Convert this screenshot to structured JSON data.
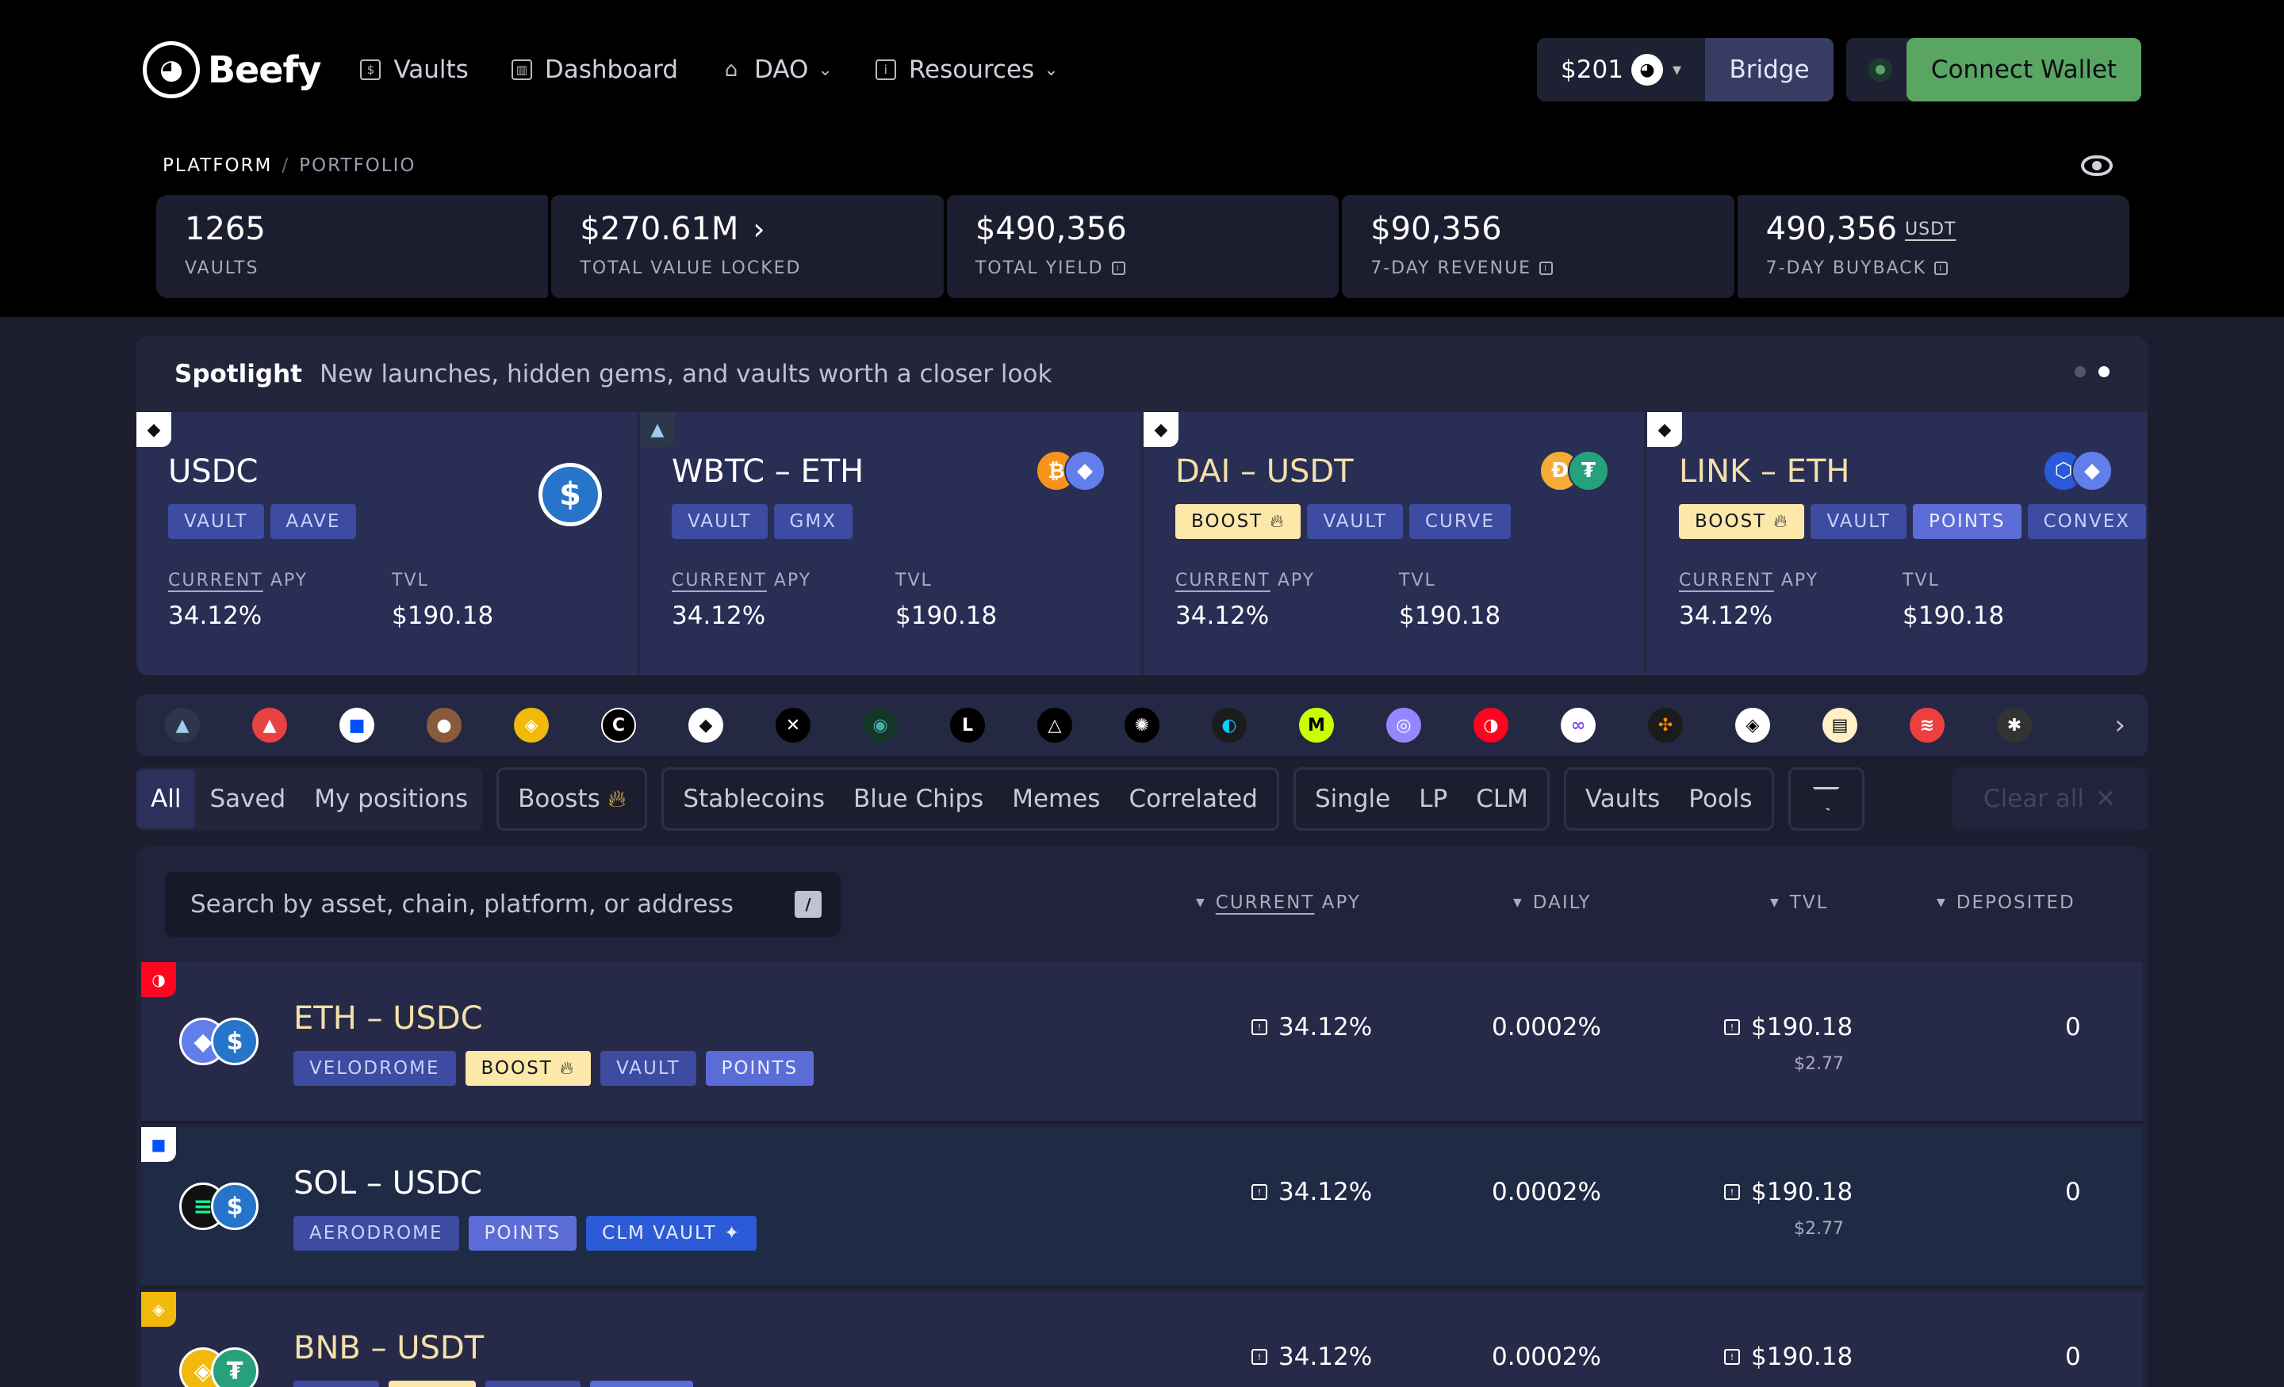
{
  "brand": {
    "name": "Beefy"
  },
  "nav": [
    {
      "label": "Vaults",
      "icon": "vault-icon"
    },
    {
      "label": "Dashboard",
      "icon": "dashboard-icon"
    },
    {
      "label": "DAO",
      "icon": "bank-icon",
      "dropdown": true
    },
    {
      "label": "Resources",
      "icon": "info-icon",
      "dropdown": true
    }
  ],
  "header": {
    "price": "$201",
    "bridge": "Bridge",
    "connect": "Connect Wallet"
  },
  "breadcrumb": {
    "root": "PLATFORM",
    "separator": "/",
    "current": "PORTFOLIO"
  },
  "stats": [
    {
      "value": "1265",
      "label": "VAULTS"
    },
    {
      "value": "$270.61M",
      "label": "TOTAL VALUE LOCKED",
      "arrow": "›"
    },
    {
      "value": "$490,356",
      "label": "TOTAL YIELD",
      "info": true
    },
    {
      "value": "$90,356",
      "label": "7-DAY REVENUE",
      "info": true
    },
    {
      "value": "490,356",
      "unit": "USDT",
      "label": "7-DAY BUYBACK",
      "info": true
    }
  ],
  "spotlight": {
    "title": "Spotlight",
    "subtitle": "New launches, hidden gems, and vaults worth a closer look",
    "apy_head_u": "CURRENT",
    "apy_head": "APY",
    "tvl_head": "TVL",
    "cards": [
      {
        "name": "USDC",
        "tags": [
          "VAULT",
          "AAVE"
        ],
        "apy": "34.12%",
        "tvl": "$190.18"
      },
      {
        "name": "WBTC – ETH",
        "tags": [
          "VAULT",
          "GMX"
        ],
        "apy": "34.12%",
        "tvl": "$190.18"
      },
      {
        "name": "DAI – USDT",
        "tags": [
          "BOOST",
          "VAULT",
          "CURVE"
        ],
        "apy": "34.12%",
        "tvl": "$190.18"
      },
      {
        "name": "LINK – ETH",
        "tags": [
          "BOOST",
          "VAULT",
          "POINTS",
          "CONVEX"
        ],
        "apy": "34.12%",
        "tvl": "$190.18"
      }
    ]
  },
  "filters": {
    "g1": [
      "All",
      "Saved",
      "My positions"
    ],
    "boosts": "Boosts",
    "g3": [
      "Stablecoins",
      "Blue Chips",
      "Memes",
      "Correlated"
    ],
    "g4": [
      "Single",
      "LP",
      "CLM"
    ],
    "g5": [
      "Vaults",
      "Pools"
    ],
    "clear": "Clear all"
  },
  "list": {
    "search_placeholder": "Search by asset, chain, platform, or address",
    "search_key": "/",
    "col_apy_u": "CURRENT",
    "col_apy": "APY",
    "col_daily": "DAILY",
    "col_tvl": "TVL",
    "col_dep": "DEPOSITED",
    "rows": [
      {
        "name": "ETH – USDC",
        "tags": [
          "VELODROME",
          "BOOST",
          "VAULT",
          "POINTS"
        ],
        "apy": "34.12%",
        "daily": "0.0002%",
        "tvl": "$190.18",
        "tvl_sub": "$2.77",
        "deposited": "0"
      },
      {
        "name": "SOL – USDC",
        "tags": [
          "AERODROME",
          "POINTS",
          "CLM VAULT"
        ],
        "apy": "34.12%",
        "daily": "0.0002%",
        "tvl": "$190.18",
        "tvl_sub": "$2.77",
        "deposited": "0"
      },
      {
        "name": "BNB – USDT",
        "tags": [],
        "apy": "34.12%",
        "daily": "0.0002%",
        "tvl": "$190.18",
        "tvl_sub": "",
        "deposited": "0"
      }
    ]
  },
  "colors": {
    "bg": "#1c1e2f",
    "header": "#000000",
    "accent_green": "#59a662",
    "boost": "#fce8a9",
    "tag": "#3d4ba0"
  }
}
